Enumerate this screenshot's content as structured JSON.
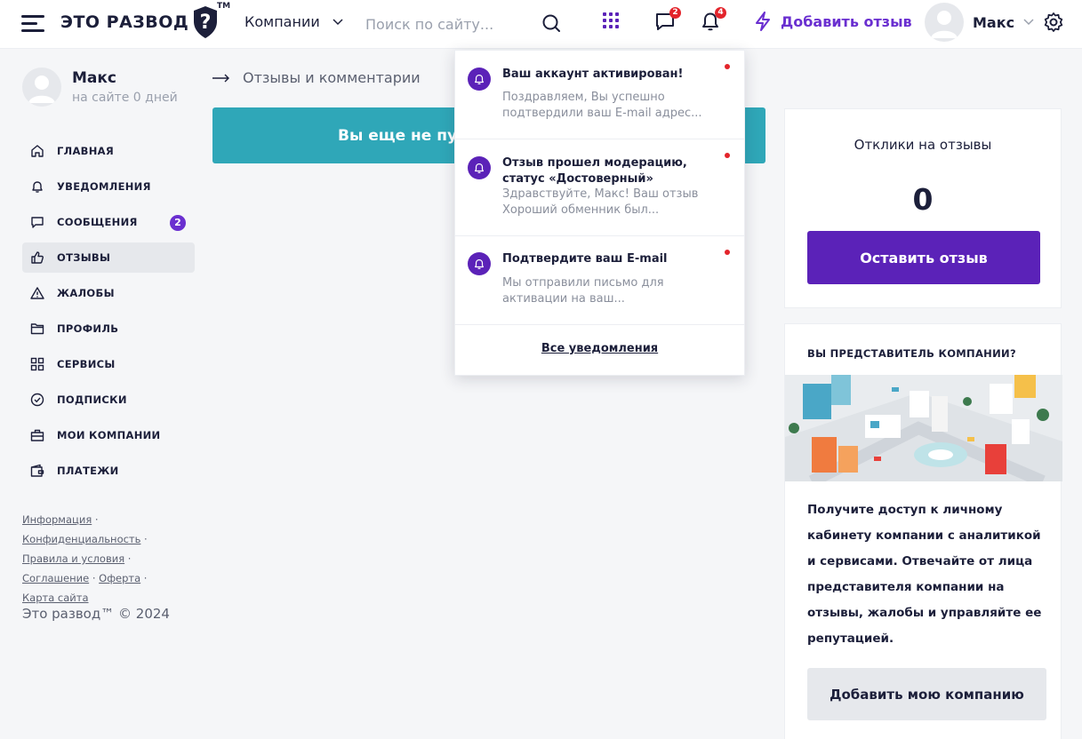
{
  "header": {
    "logo_text": "ЭТО РАЗВОД",
    "logo_mark": "?",
    "logo_tm": "TM",
    "companies_label": "Компании",
    "search_placeholder": "Поиск по сайту...",
    "messages_count": "2",
    "notifications_count": "4",
    "add_review_label": "Добавить отзыв",
    "user_name": "Макс"
  },
  "profile": {
    "name": "Макс",
    "subtitle": "на сайте 0 дней"
  },
  "nav": {
    "items": [
      {
        "label": "ГЛАВНАЯ",
        "icon": "home-icon"
      },
      {
        "label": "УВЕДОМЛЕНИЯ",
        "icon": "bell-icon"
      },
      {
        "label": "СООБЩЕНИЯ",
        "icon": "message-icon",
        "badge": "2"
      },
      {
        "label": "ОТЗЫВЫ",
        "icon": "thumbs-up-icon",
        "active": true
      },
      {
        "label": "ЖАЛОБЫ",
        "icon": "warning-icon"
      },
      {
        "label": "ПРОФИЛЬ",
        "icon": "folder-icon"
      },
      {
        "label": "СЕРВИСЫ",
        "icon": "grid-icon"
      },
      {
        "label": "ПОДПИСКИ",
        "icon": "check-circle-icon"
      },
      {
        "label": "МОИ КОМПАНИИ",
        "icon": "briefcase-icon"
      },
      {
        "label": "ПЛАТЕЖИ",
        "icon": "wallet-icon"
      }
    ]
  },
  "footer": {
    "links": [
      "Информация",
      "Конфиденциальность",
      "Правила и условия",
      "Соглашение",
      "Оферта",
      "Карта сайта"
    ],
    "copyright": "Это развод™ © 2024"
  },
  "main": {
    "breadcrumb": "Отзывы и комментарии",
    "banner_text": "Вы еще не публ"
  },
  "replies_card": {
    "title": "Отклики на отзывы",
    "count": "0",
    "button_label": "Оставить отзыв"
  },
  "company_card": {
    "title": "ВЫ ПРЕДСТАВИТЕЛЬ КОМПАНИИ?",
    "text": "Получите доступ к личному кабинету компании с аналитикой и сервисами. Отвечайте от лица представителя компании на отзывы, жалобы и управляйте ее репутацией.",
    "button_label": "Добавить мою компанию"
  },
  "notifications": {
    "items": [
      {
        "title": "Ваш аккаунт активирован!",
        "text": "Поздравляем, Вы успешно подтвердили ваш E-mail адрес..."
      },
      {
        "title": "Отзыв прошел модерацию, статус «Достоверный»",
        "text": "Здравствуйте, Макс! Ваш отзыв Хороший обменник был..."
      },
      {
        "title": "Подтвердите ваш E-mail",
        "text": "Мы отправили письмо для активации на ваш..."
      }
    ],
    "all_label": "Все уведомления"
  },
  "colors": {
    "accent": "#6a2fd0",
    "accent_dark": "#5b22b8",
    "teal": "#2fa7b8",
    "alert": "#e3242b"
  }
}
